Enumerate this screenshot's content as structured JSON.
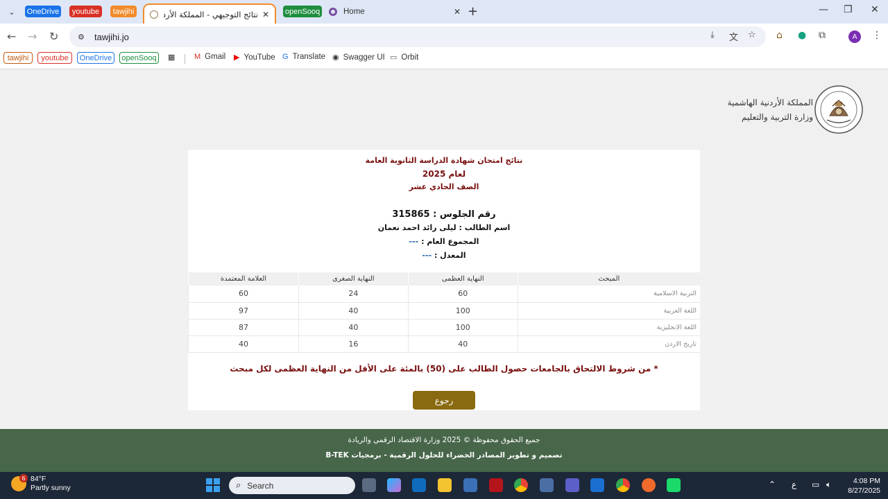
{
  "browser": {
    "tab_pills": [
      {
        "label": "OneDrive",
        "color": "#1a73e8"
      },
      {
        "label": "youtube",
        "color": "#d93025"
      },
      {
        "label": "tawjihi",
        "color": "#f28b2a"
      },
      {
        "label": "openSooq",
        "color": "#1e8e3e"
      }
    ],
    "active_tab_title": "نتائج التوجيهي - المملكة الأردنية ال",
    "home_tab_title": "Home",
    "url": "tawjihi.jo",
    "profile_initial": "A"
  },
  "bookmarks": {
    "pills": [
      {
        "label": "tawjihi",
        "color": "#c05a10"
      },
      {
        "label": "youtube",
        "color": "#d93025"
      },
      {
        "label": "OneDrive",
        "color": "#1a73e8"
      },
      {
        "label": "openSooq",
        "color": "#1e8e3e"
      }
    ],
    "items": [
      "Gmail",
      "YouTube",
      "Translate",
      "Swagger UI",
      "Orbit"
    ]
  },
  "header": {
    "ministry_line1": "المملكة الأردنية الهاشمية",
    "ministry_line2": "وزارة التربية والتعليم"
  },
  "results": {
    "title_line1": "نتائج امتحان شهادة الدراسة الثانوية العامة",
    "title_line2": "لعام 2025",
    "title_line3": "الصف الحادي عشر",
    "seat_label": "رقم الجلوس :",
    "seat_number": "315865",
    "name_label": "اسم الطالب :",
    "student_name": "ليلى رائد احمد نعمان",
    "total_label": "المجموع العام :",
    "total_value": "---",
    "average_label": "المعدل :",
    "average_value": "---",
    "columns": [
      "المبحث",
      "النهاية العظمى",
      "النهاية الصغرى",
      "العلامة المعتمدة"
    ],
    "rows": [
      {
        "subject": "التربية الاسلامية",
        "max": "60",
        "min": "24",
        "grade": "60"
      },
      {
        "subject": "اللغة العربية",
        "max": "100",
        "min": "40",
        "grade": "97"
      },
      {
        "subject": "اللغة الانجليزية",
        "max": "100",
        "min": "40",
        "grade": "87"
      },
      {
        "subject": "تاريخ الاردن",
        "max": "40",
        "min": "16",
        "grade": "40"
      }
    ],
    "note": "* من شروط الالتحاق بالجامعات حصول الطالب على (50) بالمئة على الأقل من النهاية العظمى لكل مبحث",
    "back_button": "رجوع"
  },
  "footer": {
    "line1": "جميع الحقوق محفوظة © 2025 وزارة الاقتصاد الرقمي والريادة",
    "line2": "تصميم و تطوير  المصادر الخضراء للحلول الرقمية - برمجيات B-TEK"
  },
  "taskbar": {
    "weather_temp": "84°F",
    "weather_desc": "Partly sunny",
    "weather_badge": "6",
    "search_placeholder": "Search",
    "lang_indicator": "ع",
    "time": "4:08 PM",
    "date": "8/27/2025"
  }
}
